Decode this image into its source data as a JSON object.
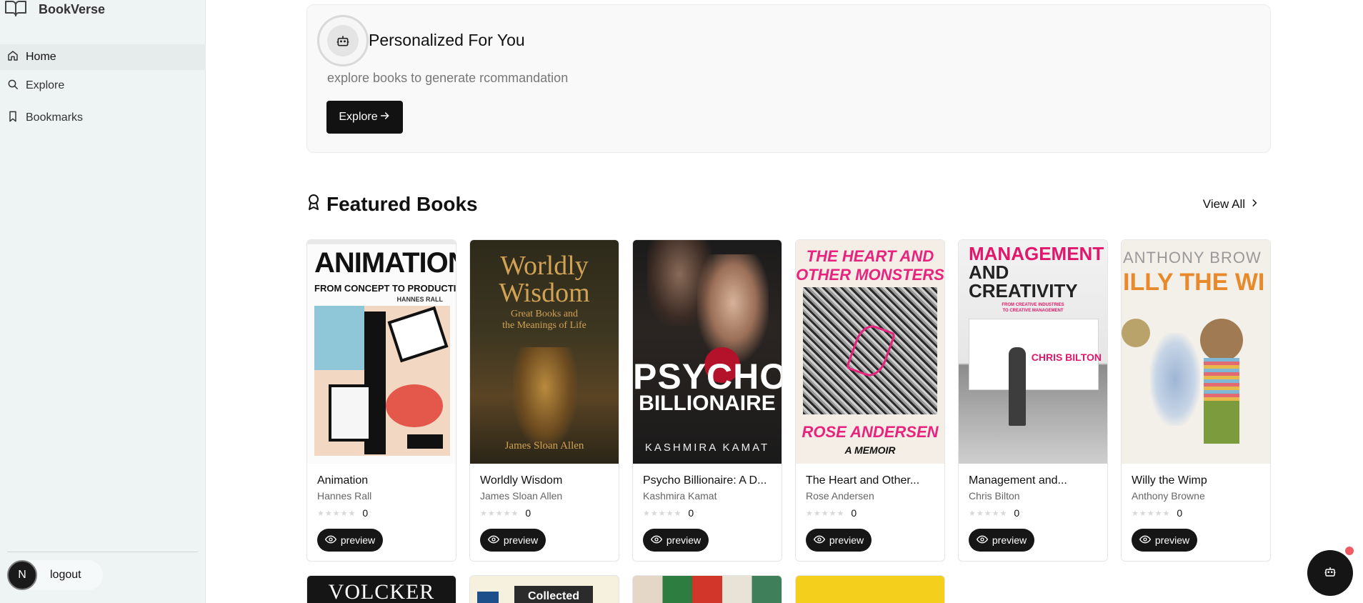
{
  "brand": {
    "name": "BookVerse",
    "icon": "open-book-icon"
  },
  "sidebar": {
    "items": [
      {
        "label": "Home",
        "icon": "home-icon"
      },
      {
        "label": "Explore",
        "icon": "search-icon"
      },
      {
        "label": "Bookmarks",
        "icon": "bookmark-icon"
      }
    ],
    "logout_label": "logout",
    "avatar_initial": "N"
  },
  "promo": {
    "title": "Personalized For You",
    "subtitle": "explore books to generate rcommandation",
    "button_label": "Explore",
    "icon": "bot-icon"
  },
  "featured": {
    "title": "Featured Books",
    "icon": "award-icon",
    "view_all_label": "View All",
    "books": [
      {
        "title": "Animation",
        "author": "Hannes Rall",
        "rating": "0",
        "preview_label": "preview",
        "cover_text": [
          "ANIMATION",
          "FROM CONCEPT TO PRODUCTION",
          "HANNES RALL"
        ]
      },
      {
        "title": "Worldly Wisdom",
        "author": "James Sloan Allen",
        "rating": "0",
        "preview_label": "preview",
        "cover_text": [
          "Worldly",
          "Wisdom",
          "Great Books and",
          "the Meanings of Life",
          "James Sloan Allen"
        ]
      },
      {
        "title": "Psycho Billionaire: A D...",
        "author": "Kashmira Kamat",
        "rating": "0",
        "preview_label": "preview",
        "cover_text": [
          "PSYCHO",
          "BILLIONAIRE",
          "KASHMIRA KAMAT"
        ]
      },
      {
        "title": "The Heart and Other...",
        "author": "Rose Andersen",
        "rating": "0",
        "preview_label": "preview",
        "cover_text": [
          "THE HEART AND",
          "OTHER MONSTERS",
          "ROSE ANDERSEN",
          "A MEMOIR"
        ]
      },
      {
        "title": "Management and...",
        "author": "Chris Bilton",
        "rating": "0",
        "preview_label": "preview",
        "cover_text": [
          "MANAGEMENT",
          "AND",
          "CREATIVITY",
          "FROM CREATIVE INDUSTRIES",
          "TO CREATIVE MANAGEMENT",
          "CHRIS BILTON"
        ]
      },
      {
        "title": "Willy the Wimp",
        "author": "Anthony Browne",
        "rating": "0",
        "preview_label": "preview",
        "cover_text": [
          "ANTHONY BROW",
          "ILLY THE WI"
        ]
      }
    ],
    "next_row_cover_text": [
      "VOLCKER",
      "Collected"
    ]
  },
  "chat_fab": {
    "icon": "bot-icon"
  },
  "colors": {
    "sidebar_bg": "#eef3f3",
    "button_dark": "#121212",
    "notification_dot": "#f05a63"
  }
}
